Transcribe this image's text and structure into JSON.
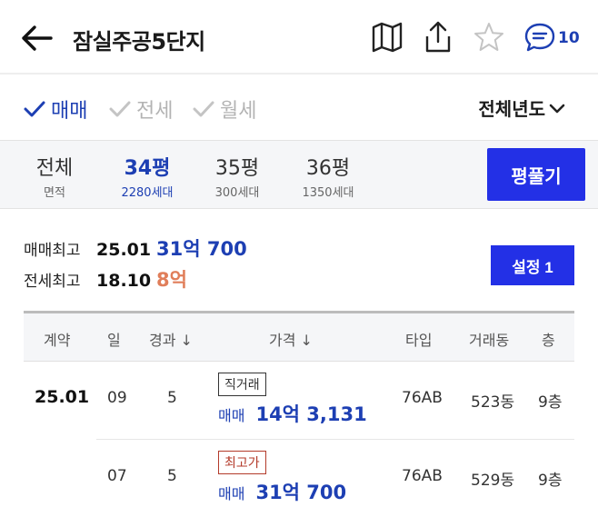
{
  "header": {
    "title": "잠실주공5단지",
    "comment_count": "10"
  },
  "filter": {
    "options": [
      {
        "label": "매매",
        "active": true
      },
      {
        "label": "전세",
        "active": false
      },
      {
        "label": "월세",
        "active": false
      }
    ],
    "year_select": "전체년도"
  },
  "area_tabs": {
    "all_label": "전체",
    "all_sub": "면적",
    "tabs": [
      {
        "label": "34평",
        "sub": "2280세대",
        "active": true
      },
      {
        "label": "35평",
        "sub": "300세대",
        "active": false
      },
      {
        "label": "36평",
        "sub": "1350세대",
        "active": false
      }
    ],
    "pyeong_button": "평풀기"
  },
  "summary": {
    "sale_label": "매매최고",
    "sale_date": "25.01",
    "sale_price": "31억 700",
    "jeonse_label": "전세최고",
    "jeonse_date": "18.10",
    "jeonse_price": "8억",
    "setting_button": "설정 1"
  },
  "table": {
    "headers": [
      "계약",
      "일",
      "경과 ↓",
      "가격 ↓",
      "타입",
      "거래동",
      "층"
    ],
    "month": "25.01",
    "rows": [
      {
        "day": "09",
        "elapsed": "5",
        "badge": "직거래",
        "kind": "매매",
        "price": "14억 3,131",
        "type": "76AB",
        "dong": "523동",
        "floor": "9층"
      },
      {
        "day": "07",
        "elapsed": "5",
        "badge": "최고가",
        "kind": "매매",
        "price": "31억 700",
        "type": "76AB",
        "dong": "529동",
        "floor": "9층"
      }
    ]
  },
  "colors": {
    "accent_blue": "#1d3fb3",
    "button_blue": "#2330e6",
    "jeonse_orange": "#e07e5a",
    "badge_red": "#b33a2a"
  },
  "icons": [
    "arrow-left-icon",
    "map-icon",
    "share-icon",
    "star-icon",
    "chat-icon",
    "check-icon",
    "chevron-down-icon"
  ]
}
